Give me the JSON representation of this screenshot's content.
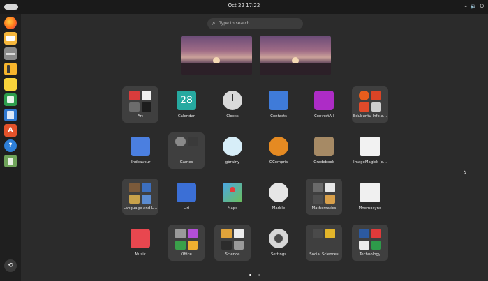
{
  "topbar": {
    "clock": "Oct 22 17:22",
    "tray": [
      "⌁",
      "🔉",
      "⏻"
    ]
  },
  "search": {
    "placeholder": "Type to search"
  },
  "apps": [
    "Art",
    "Calendar",
    "Clocks",
    "Contacts",
    "ConvertAll",
    "Edubuntu Info a…",
    "Endeavour",
    "Games",
    "gbrainy",
    "GCompris",
    "Gradebook",
    "ImageMagick (c…",
    "Language and L…",
    "Liri",
    "Maps",
    "Marble",
    "Mathematics",
    "Mnemosyne",
    "Music",
    "Office",
    "Science",
    "Settings",
    "Social Sciences",
    "Technology"
  ],
  "calendar_day": "28",
  "pager": {
    "pages": 2,
    "current": 1
  },
  "colors": {
    "background": "#2b2b2b",
    "topbar": "#1a1a1a",
    "dock": "#1f1f1f",
    "folder": "#3f3f3f"
  },
  "icons": {
    "dock": [
      "firefox-icon",
      "mail-icon",
      "files-icon",
      "notes-icon",
      "sticky-notes-icon",
      "spreadsheet-icon",
      "text-editor-icon",
      "app-store-icon",
      "help-icon",
      "trash-icon",
      "app-grid-icon"
    ],
    "pager_next": "chevron-right-icon"
  }
}
